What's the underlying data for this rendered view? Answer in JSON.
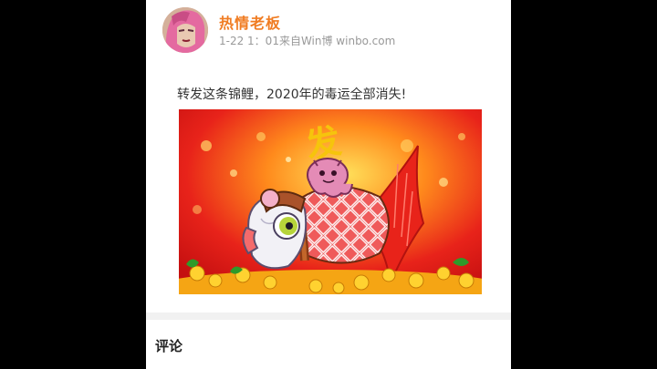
{
  "post": {
    "username": "热情老板",
    "meta": "1-22 1：01来自Win博  winbo.com",
    "text": "转发这条锦鲤，2020年的毒运全部消失!",
    "image": {
      "title_glyph": "发",
      "colors": {
        "red": "#e31e12",
        "gold": "#f6c40c",
        "pink": "#e48bb6"
      }
    }
  },
  "comments": {
    "title": "评论"
  }
}
